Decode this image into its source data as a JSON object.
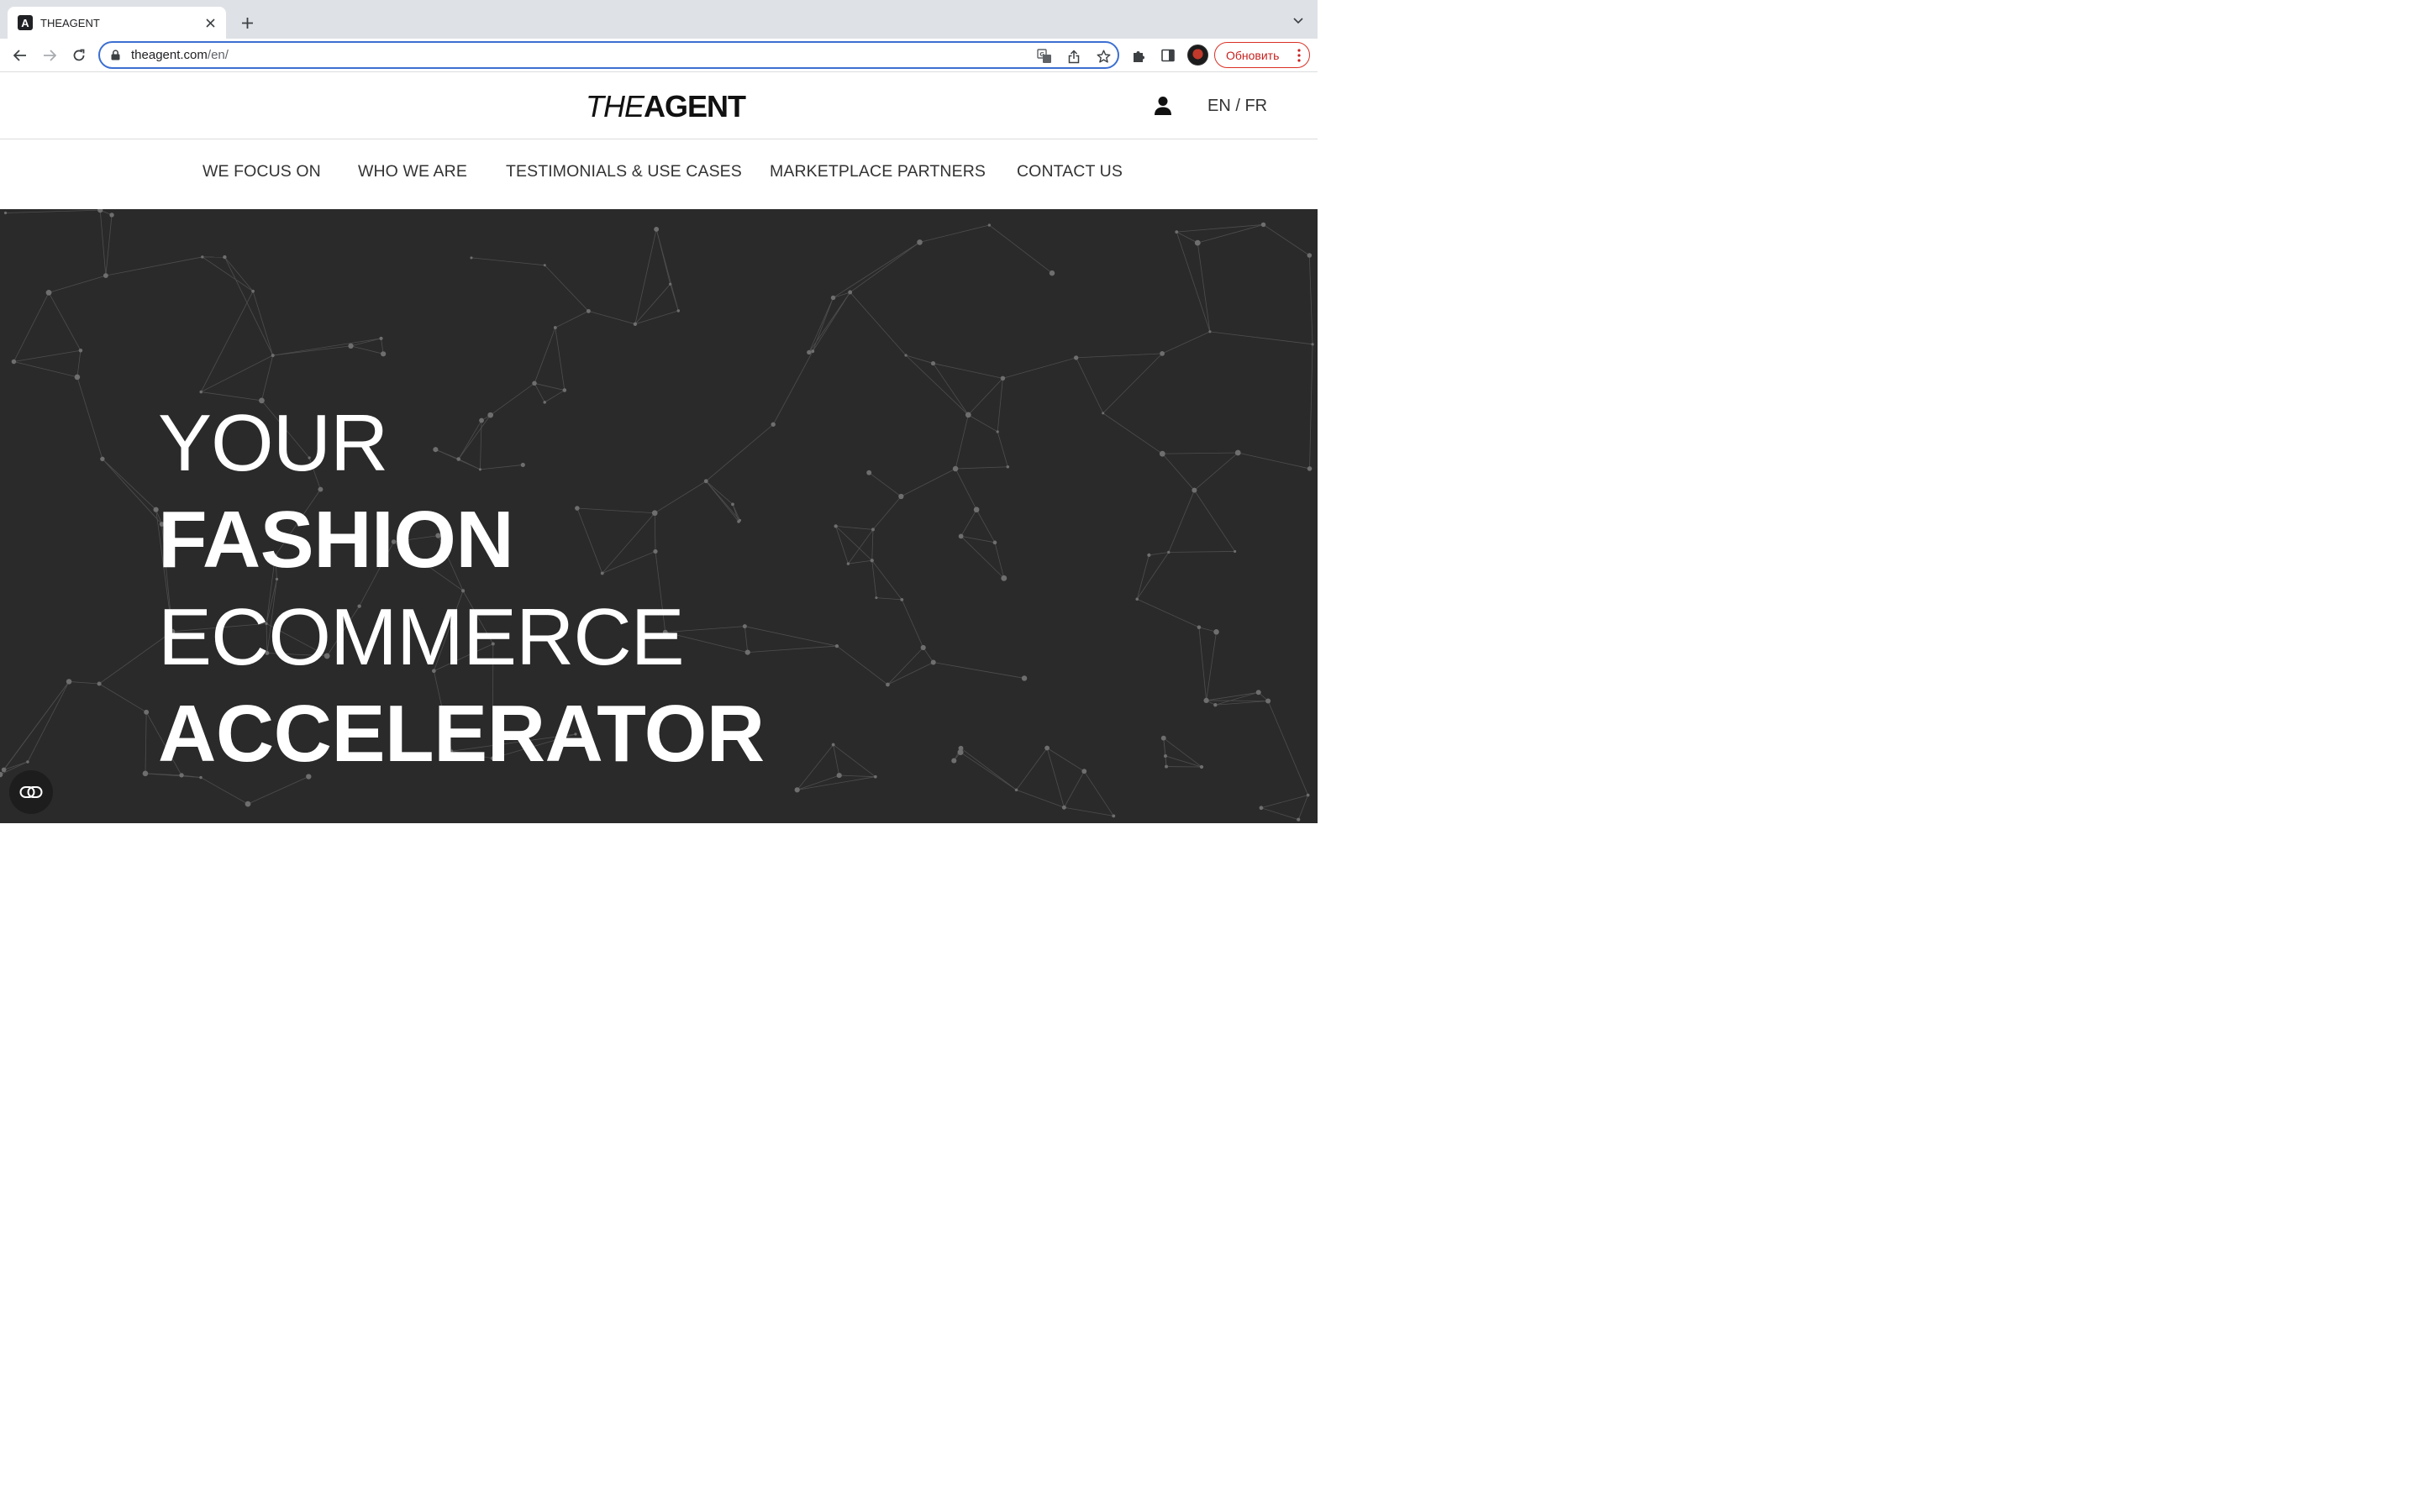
{
  "browser": {
    "tab_title": "THEAGENT",
    "favicon_letter": "A",
    "url_host": "theagent.com",
    "url_path": "/en/",
    "update_button": "Обновить"
  },
  "site": {
    "logo_the": "THE",
    "logo_agent": "AGENT",
    "language": "EN / FR",
    "nav": [
      "WE FOCUS ON",
      "WHO WE ARE",
      "TESTIMONIALS & USE CASES",
      "MARKETPLACE PARTNERS",
      "CONTACT US"
    ]
  },
  "hero": {
    "line1": "YOUR",
    "line2": "FASHION",
    "line3": "ECOMMERCE",
    "line4": "ACCELERATOR"
  },
  "colors": {
    "hero_bg": "#2a2a2a",
    "omnibox_border": "#3c6fd1",
    "update_red": "#c5221f"
  }
}
